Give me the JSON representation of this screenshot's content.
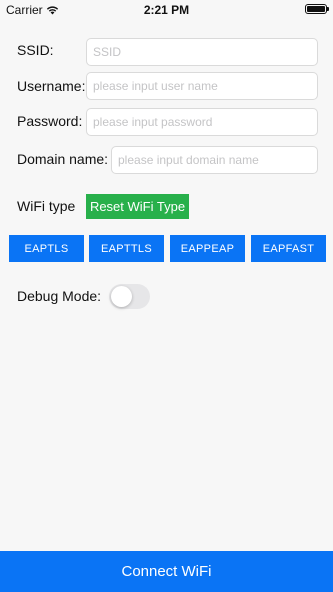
{
  "status_bar": {
    "carrier": "Carrier",
    "time": "2:21 PM",
    "wifi_icon": "wifi-icon",
    "battery_icon": "battery-icon",
    "battery_level": 1.0
  },
  "form": {
    "ssid": {
      "label": "SSID:",
      "value": "",
      "placeholder": "SSID"
    },
    "username": {
      "label": "Username:",
      "value": "",
      "placeholder": "please input user name"
    },
    "password": {
      "label": "Password:",
      "value": "",
      "placeholder": "please input password"
    },
    "domain": {
      "label": "Domain name:",
      "value": "",
      "placeholder": "please input domain name"
    }
  },
  "wifi_type": {
    "label": "WiFi type",
    "reset_label": "Reset WiFi Type",
    "reset_color": "#28b04b",
    "options": [
      "EAPTLS",
      "EAPTTLS",
      "EAPPEAP",
      "EAPFAST"
    ],
    "option_color": "#0a74f5"
  },
  "debug": {
    "label": "Debug Mode:",
    "enabled": false
  },
  "connect": {
    "label": "Connect WiFi",
    "color": "#0a74f5"
  }
}
